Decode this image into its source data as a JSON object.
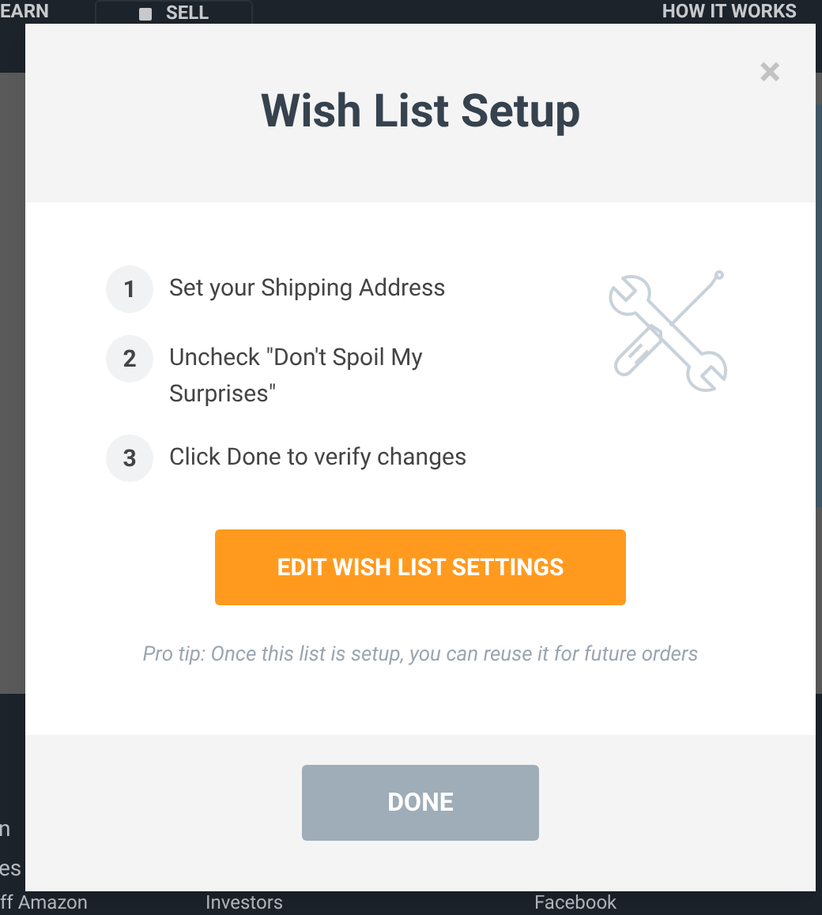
{
  "background": {
    "nav": [
      {
        "label": "EARN",
        "kind": "plain"
      },
      {
        "label": "SELL",
        "kind": "icon"
      },
      {
        "label": "HOW IT WORKS",
        "kind": "right"
      }
    ],
    "footer": [
      "n",
      "es"
    ],
    "footer_links": [
      "ff Amazon",
      "Investors",
      "Facebook"
    ]
  },
  "modal": {
    "title": "Wish List Setup",
    "close": "×",
    "steps": [
      {
        "number": "1",
        "text": "Set your Shipping Address"
      },
      {
        "number": "2",
        "text": "Uncheck \"Don't Spoil My Surprises\""
      },
      {
        "number": "3",
        "text": "Click Done to verify changes"
      }
    ],
    "action_button": "EDIT WISH LIST SETTINGS",
    "tip": "Pro tip: Once this list is setup, you can reuse it for future orders",
    "done_button": "DONE"
  }
}
